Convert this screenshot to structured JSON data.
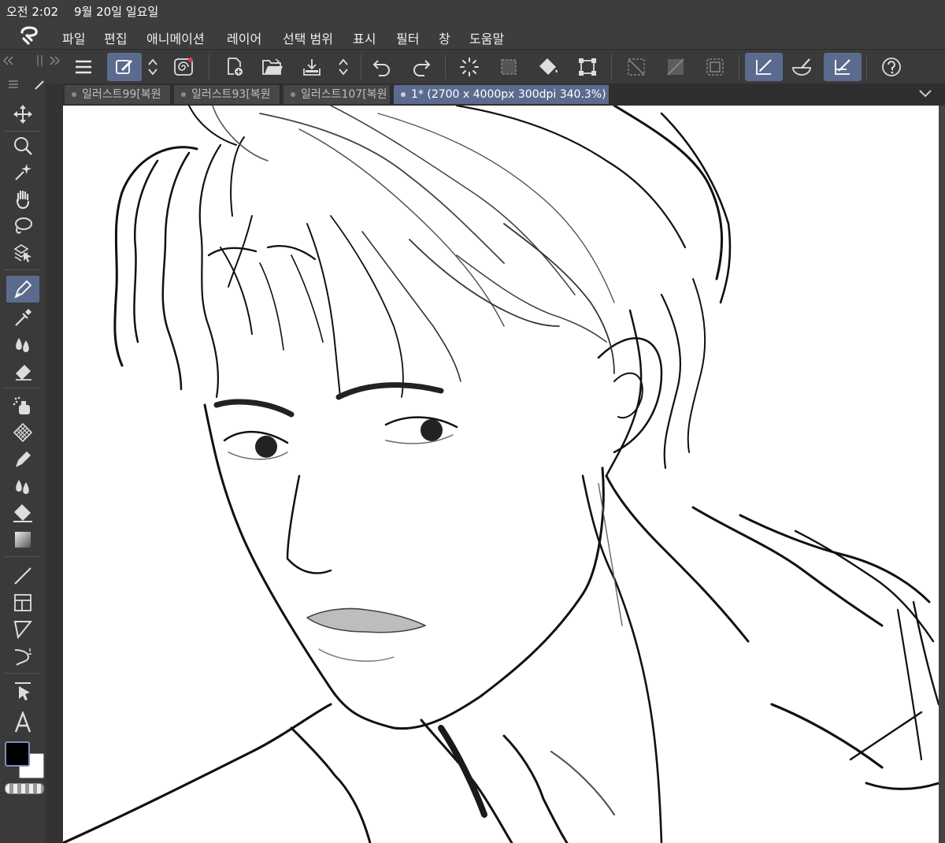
{
  "status_bar": {
    "time": "오전 2:02",
    "date": "9월 20일 일요일"
  },
  "menu": [
    "파일",
    "편집",
    "애니메이션",
    "레이어",
    "선택 범위",
    "표시",
    "필터",
    "창",
    "도움말"
  ],
  "tabs": [
    {
      "label": "일러스트99[복원"
    },
    {
      "label": "일러스트93[복원"
    },
    {
      "label": "일러스트107[복원"
    },
    {
      "label": "1* (2700 x 4000px 300dpi 340.3%)"
    }
  ],
  "toolbar_icons": [
    "menu-icon",
    "pen-settings-icon",
    "up-down-icon",
    "spiral-icon",
    "new-canvas-icon",
    "open-folder-icon",
    "save-icon",
    "up-down-icon",
    "undo-icon",
    "redo-icon",
    "loading-icon",
    "clear-selection-icon",
    "fill-icon",
    "transform-icon",
    "hide-selection-icon",
    "fill-pattern-icon",
    "border-icon",
    "snap-ruler-icon",
    "brush-snap-icon",
    "snap-grid-icon",
    "help-icon"
  ],
  "tools": [
    "move-icon",
    "zoom-icon",
    "auto-select-icon",
    "hand-icon",
    "lasso-icon",
    "select-layer-icon",
    "pen-icon",
    "eyedropper-icon",
    "blend-icon",
    "eraser-icon",
    "airbrush-icon",
    "pattern-icon",
    "decoration-icon",
    "blur-icon",
    "fill-icon",
    "gradient-icon",
    "line-icon",
    "frame-icon",
    "ruler-icon",
    "tone-icon",
    "object-select-icon",
    "text-icon"
  ],
  "colors": {
    "main": "#000000",
    "sub": "#ffffff",
    "accent": "#5b6b8e"
  }
}
